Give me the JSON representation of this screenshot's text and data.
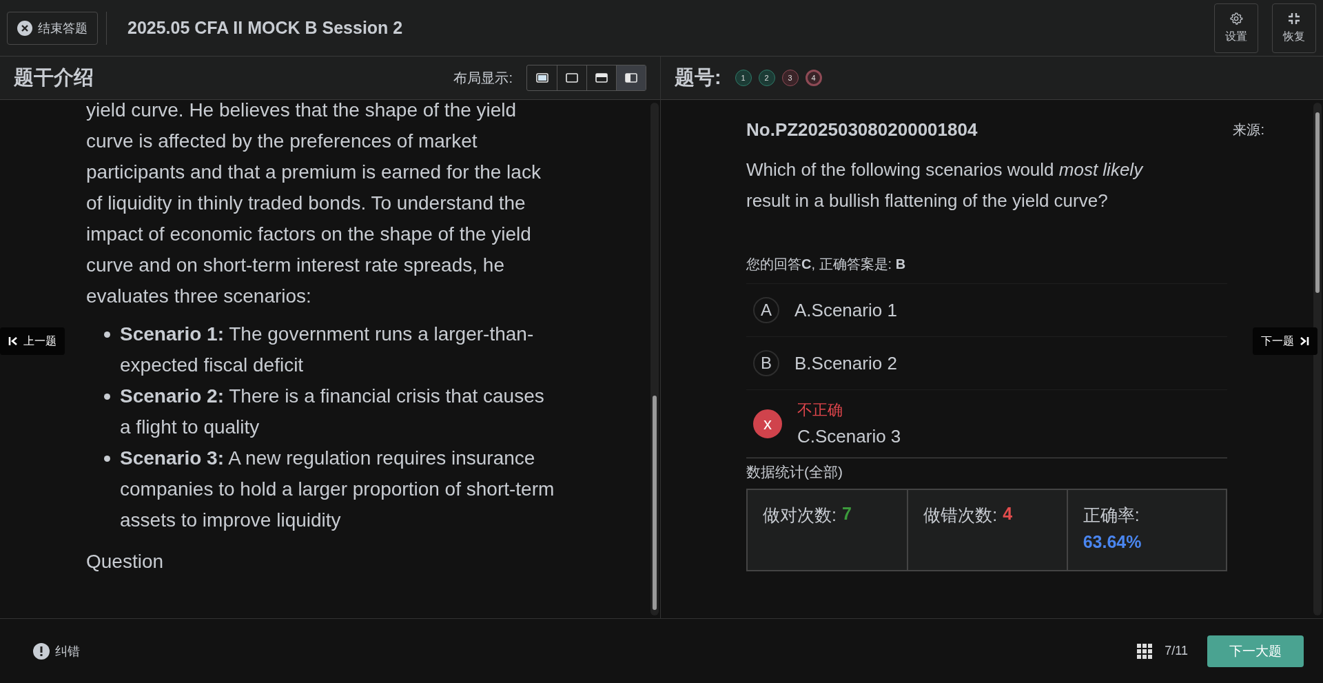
{
  "top_bar": {
    "end_button": "结束答题",
    "title": "2025.05 CFA II MOCK B Session 2",
    "buttons": [
      {
        "kind": "settings",
        "label": "设置"
      },
      {
        "kind": "restore",
        "label": "恢复"
      }
    ]
  },
  "left_panel": {
    "title": "题干介绍",
    "layout_label": "布局显示:",
    "layouts": [
      {
        "kind": "full",
        "selected": false
      },
      {
        "kind": "blank",
        "selected": false
      },
      {
        "kind": "split-horizontal",
        "selected": false
      },
      {
        "kind": "split-vertical",
        "selected": true
      }
    ],
    "paragraph": "yield curve. He believes that the shape of the yield curve is affected by the preferences of market participants and that a premium is earned for the lack of liquidity in thinly traded bonds. To understand the impact of economic factors on the shape of the yield curve and on short-term interest rate spreads, he evaluates three scenarios:",
    "bullets": [
      "**Scenario 1:** The government runs a larger-than-expected fiscal deficit",
      "**Scenario 2:** There is a financial crisis that causes a flight to quality",
      "**Scenario 3:** A new regulation requires insurance companies to hold a larger proportion of short-term assets to improve liquidity"
    ],
    "heading": "Question",
    "prev_button": "上一题"
  },
  "right_panel": {
    "title": "题号:",
    "numbers": [
      {
        "label": "1",
        "correct": true,
        "selected": false
      },
      {
        "label": "2",
        "correct": true,
        "selected": false
      },
      {
        "label": "3",
        "correct": false,
        "selected": false
      },
      {
        "label": "4",
        "correct": false,
        "selected": true
      }
    ],
    "question_id": "No.PZ202503080200001804",
    "source_label": "来源:",
    "question": "Which of the following scenarios would *most likely* result in a bullish flattening of the yield curve?",
    "answer_line": "您的回答**C**, 正确答案是: **B**",
    "options": [
      {
        "letter": "A",
        "text": "A.Scenario 1",
        "wrong": false
      },
      {
        "letter": "B",
        "text": "B.Scenario 2",
        "wrong": false
      },
      {
        "letter": "x",
        "text": "C.Scenario 3",
        "wrong": true,
        "verdict": "不正确"
      }
    ],
    "stats_title": "数据统计(全部)",
    "stats": [
      {
        "label": "做对次数:",
        "value": "7",
        "kind": "correct"
      },
      {
        "label": "做错次数:",
        "value": "4",
        "kind": "wrong"
      },
      {
        "label": "正确率:",
        "value": "63.64%",
        "kind": "rate"
      }
    ],
    "next_button": "下一题"
  },
  "bottom_bar": {
    "report": "纠错",
    "progress": "7/11",
    "next_section": "下一大题"
  }
}
